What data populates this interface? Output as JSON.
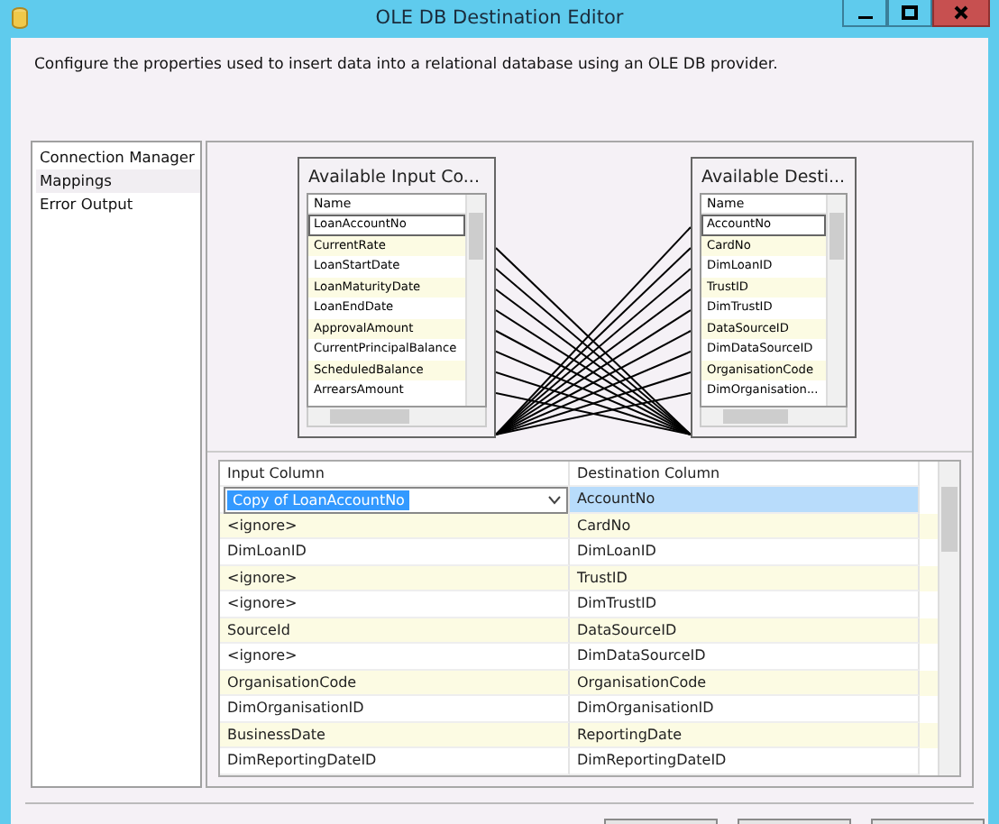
{
  "window": {
    "title": "OLE DB Destination Editor"
  },
  "description": "Configure the properties used to insert data into a relational database using an OLE DB provider.",
  "nav": [
    {
      "label": "Connection Manager",
      "selected": false
    },
    {
      "label": "Mappings",
      "selected": true
    },
    {
      "label": "Error Output",
      "selected": false
    }
  ],
  "input_table": {
    "title": "Available Input Co...",
    "header": "Name",
    "rows": [
      "LoanAccountNo",
      "CurrentRate",
      "LoanStartDate",
      "LoanMaturityDate",
      "LoanEndDate",
      "ApprovalAmount",
      "CurrentPrincipalBalance",
      "ScheduledBalance",
      "ArrearsAmount"
    ]
  },
  "dest_table": {
    "title": "Available Desti...",
    "header": "Name",
    "rows": [
      "AccountNo",
      "CardNo",
      "DimLoanID",
      "TrustID",
      "DimTrustID",
      "DataSourceID",
      "DimDataSourceID",
      "OrganisationCode",
      "DimOrganisation..."
    ]
  },
  "mappings": {
    "columns": [
      "Input Column",
      "Destination Column"
    ],
    "rows": [
      {
        "input": "Copy of LoanAccountNo",
        "destination": "AccountNo",
        "selected": true
      },
      {
        "input": "<ignore>",
        "destination": "CardNo",
        "selected": false
      },
      {
        "input": "DimLoanID",
        "destination": "DimLoanID",
        "selected": false
      },
      {
        "input": "<ignore>",
        "destination": "TrustID",
        "selected": false
      },
      {
        "input": "<ignore>",
        "destination": "DimTrustID",
        "selected": false
      },
      {
        "input": "SourceId",
        "destination": "DataSourceID",
        "selected": false
      },
      {
        "input": "<ignore>",
        "destination": "DimDataSourceID",
        "selected": false
      },
      {
        "input": "OrganisationCode",
        "destination": "OrganisationCode",
        "selected": false
      },
      {
        "input": "DimOrganisationID",
        "destination": "DimOrganisationID",
        "selected": false
      },
      {
        "input": "BusinessDate",
        "destination": "ReportingDate",
        "selected": false
      },
      {
        "input": "DimReportingDateID",
        "destination": "DimReportingDateID",
        "selected": false
      }
    ]
  }
}
